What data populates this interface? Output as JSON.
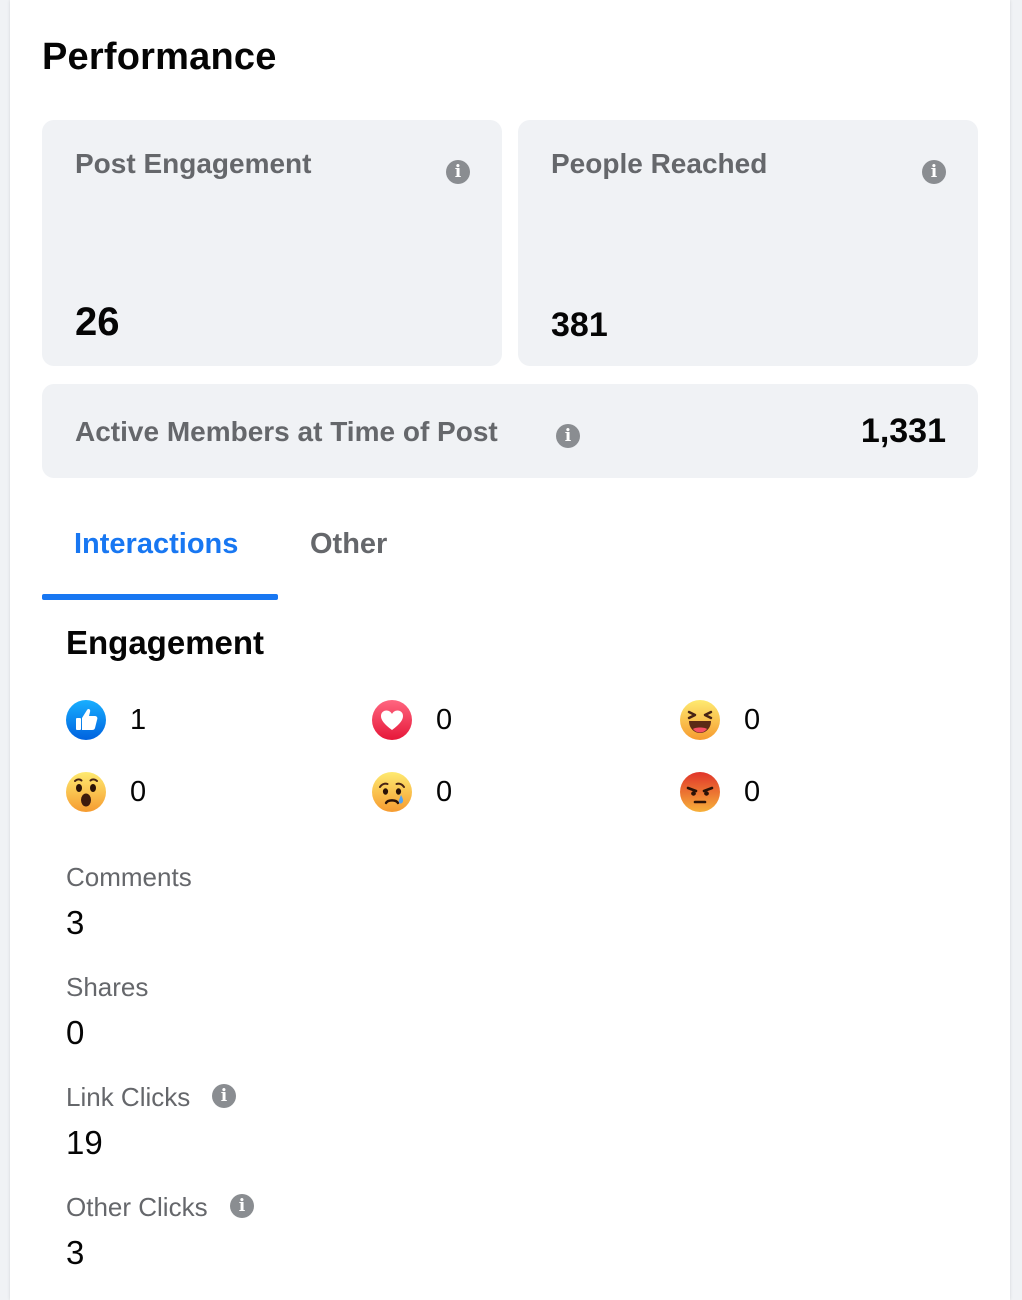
{
  "page": {
    "title": "Performance"
  },
  "cards": {
    "post_engagement": {
      "label": "Post Engagement",
      "value": "26",
      "icon": "info-icon"
    },
    "people_reached": {
      "label": "People Reached",
      "value": "381",
      "icon": "info-icon"
    },
    "active_members": {
      "label": "Active Members at Time of Post",
      "value": "1,331",
      "icon": "info-icon"
    }
  },
  "tabs": [
    {
      "label": "Interactions",
      "active": true
    },
    {
      "label": "Other",
      "active": false
    }
  ],
  "engagement": {
    "title": "Engagement",
    "reactions": [
      {
        "name": "like",
        "icon": "like-icon",
        "count": "1"
      },
      {
        "name": "love",
        "icon": "love-icon",
        "count": "0"
      },
      {
        "name": "haha",
        "icon": "haha-icon",
        "count": "0"
      },
      {
        "name": "wow",
        "icon": "wow-icon",
        "count": "0"
      },
      {
        "name": "sad",
        "icon": "sad-icon",
        "count": "0"
      },
      {
        "name": "angry",
        "icon": "angry-icon",
        "count": "0"
      }
    ],
    "metrics": [
      {
        "label": "Comments",
        "value": "3"
      },
      {
        "label": "Shares",
        "value": "0"
      },
      {
        "label": "Link Clicks",
        "value": "19",
        "icon": "info-icon"
      },
      {
        "label": "Other Clicks",
        "value": "3",
        "icon": "info-icon"
      }
    ]
  },
  "colors": {
    "accent": "#1877f2",
    "secondary_text": "#65676b",
    "card_bg": "#f0f2f5",
    "love": "#f33e58",
    "emoji_yellow": "#f7c64b",
    "angry": "#e9710f"
  }
}
